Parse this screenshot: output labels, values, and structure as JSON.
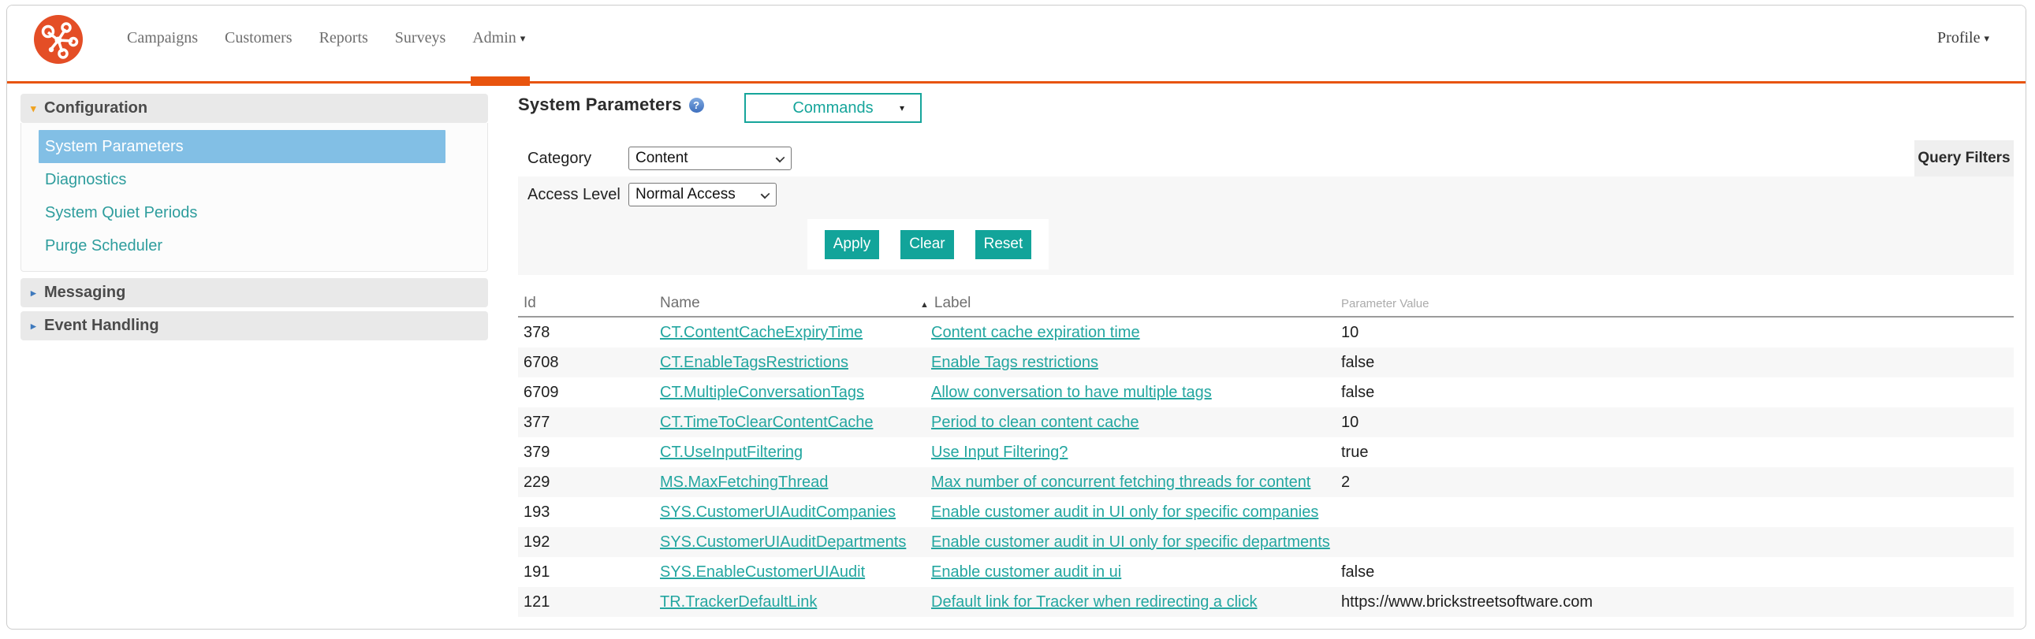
{
  "icons": {
    "help": "?",
    "caret_down": "▾",
    "caret_right": "▸",
    "sort_asc": "▲"
  },
  "colors": {
    "accent_orange": "#E8540E",
    "button_teal": "#12A49A",
    "link_teal": "#23A6A0",
    "selected_blue": "#82BFE5"
  },
  "nav": {
    "items": [
      {
        "label": "Campaigns"
      },
      {
        "label": "Customers"
      },
      {
        "label": "Reports"
      },
      {
        "label": "Surveys"
      },
      {
        "label": "Admin",
        "caret": true,
        "active": true
      }
    ],
    "profile_label": "Profile"
  },
  "sidebar": {
    "sections": [
      {
        "label": "Configuration",
        "expanded": true,
        "items": [
          {
            "label": "System Parameters",
            "selected": true
          },
          {
            "label": "Diagnostics"
          },
          {
            "label": "System Quiet Periods"
          },
          {
            "label": "Purge Scheduler"
          }
        ]
      },
      {
        "label": "Messaging",
        "expanded": false
      },
      {
        "label": "Event Handling",
        "expanded": false
      }
    ]
  },
  "main": {
    "title": "System Parameters",
    "commands_dropdown": {
      "value": "Commands"
    },
    "filters": {
      "query_filters_label": "Query Filters",
      "category": {
        "label": "Category",
        "value": "Content"
      },
      "access_level": {
        "label": "Access Level",
        "value": "Normal Access"
      },
      "buttons": {
        "apply": "Apply",
        "clear": "Clear",
        "reset": "Reset"
      }
    },
    "table": {
      "columns": {
        "id": "Id",
        "name": "Name",
        "label": "Label",
        "value": "Parameter Value"
      },
      "sort_column": "Label",
      "sort_direction": "ascending",
      "rows": [
        {
          "id": "378",
          "name": "CT.ContentCacheExpiryTime",
          "label": "Content cache expiration time",
          "value": "10"
        },
        {
          "id": "6708",
          "name": "CT.EnableTagsRestrictions",
          "label": "Enable Tags restrictions",
          "value": "false"
        },
        {
          "id": "6709",
          "name": "CT.MultipleConversationTags",
          "label": "Allow conversation to have multiple tags",
          "value": "false"
        },
        {
          "id": "377",
          "name": "CT.TimeToClearContentCache",
          "label": "Period to clean content cache",
          "value": "10"
        },
        {
          "id": "379",
          "name": "CT.UseInputFiltering",
          "label": "Use Input Filtering?",
          "value": "true"
        },
        {
          "id": "229",
          "name": "MS.MaxFetchingThread",
          "label": "Max number of concurrent fetching threads for content",
          "value": "2"
        },
        {
          "id": "193",
          "name": "SYS.CustomerUIAuditCompanies",
          "label": "Enable customer audit in UI only for specific companies",
          "value": ""
        },
        {
          "id": "192",
          "name": "SYS.CustomerUIAuditDepartments",
          "label": "Enable customer audit in UI only for specific departments",
          "value": ""
        },
        {
          "id": "191",
          "name": "SYS.EnableCustomerUIAudit",
          "label": "Enable customer audit in ui",
          "value": "false"
        },
        {
          "id": "121",
          "name": "TR.TrackerDefaultLink",
          "label": "Default link for Tracker when redirecting a click",
          "value": "https://www.brickstreetsoftware.com"
        }
      ]
    }
  }
}
